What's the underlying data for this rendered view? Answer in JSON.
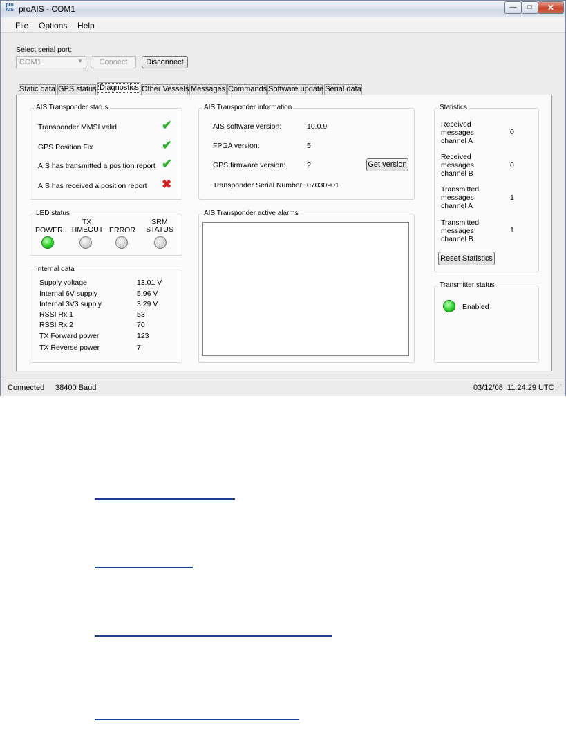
{
  "window": {
    "title": "proAIS - COM1",
    "logo_text": "pro AIS",
    "minimize_glyph": "—",
    "maximize_glyph": "□",
    "close_glyph": "✕"
  },
  "menu": {
    "file": "File",
    "options": "Options",
    "help": "Help"
  },
  "serial": {
    "label": "Select serial port:",
    "selected_port": "COM1",
    "connect_label": "Connect",
    "disconnect_label": "Disconnect"
  },
  "tabs": [
    {
      "label": "Static data"
    },
    {
      "label": "GPS status"
    },
    {
      "label": "Diagnostics"
    },
    {
      "label": "Other Vessels"
    },
    {
      "label": "Messages"
    },
    {
      "label": "Commands"
    },
    {
      "label": "Software update"
    },
    {
      "label": "Serial data"
    }
  ],
  "transponder_status": {
    "title": "AIS Transponder status",
    "items": [
      {
        "label": "Transponder MMSI valid",
        "ok": true
      },
      {
        "label": "GPS Position Fix",
        "ok": true
      },
      {
        "label": "AIS has transmitted a position report",
        "ok": true
      },
      {
        "label": "AIS has received a position report",
        "ok": false
      }
    ],
    "check_glyph": "✔",
    "cross_glyph": "✖"
  },
  "led_status": {
    "title": "LED status",
    "leds": [
      {
        "label": "POWER",
        "on": true
      },
      {
        "label": "TX\nTIMEOUT",
        "on": false
      },
      {
        "label": "ERROR",
        "on": false
      },
      {
        "label": "SRM\nSTATUS",
        "on": false
      }
    ]
  },
  "internal_data": {
    "title": "Internal data",
    "rows": [
      {
        "label": "Supply voltage",
        "value": "13.01 V"
      },
      {
        "label": "Internal 6V supply",
        "value": "5.96 V"
      },
      {
        "label": "Internal 3V3 supply",
        "value": "3.29 V"
      },
      {
        "label": "RSSI Rx 1",
        "value": "53"
      },
      {
        "label": "RSSI Rx 2",
        "value": "70"
      },
      {
        "label": "TX Forward power",
        "value": "123"
      },
      {
        "label": "TX Reverse power",
        "value": "7"
      }
    ]
  },
  "transponder_info": {
    "title": "AIS Transponder information",
    "rows": [
      {
        "label": "AIS software version:",
        "value": "10.0.9"
      },
      {
        "label": "FPGA version:",
        "value": "5"
      },
      {
        "label": "GPS firmware version:",
        "value": "?"
      },
      {
        "label": "Transponder Serial Number:",
        "value": "07030901"
      }
    ],
    "get_version_label": "Get version"
  },
  "alarms": {
    "title": "AIS Transponder active alarms"
  },
  "statistics": {
    "title": "Statistics",
    "rows": [
      {
        "label": "Received\nmessages\nchannel A",
        "value": "0"
      },
      {
        "label": "Received\nmessages\nchannel B",
        "value": "0"
      },
      {
        "label": "Transmitted\nmessages\nchannel A",
        "value": "1"
      },
      {
        "label": "Transmitted\nmessages\nchannel B",
        "value": "1"
      }
    ],
    "reset_label": "Reset Statistics"
  },
  "transmitter": {
    "title": "Transmitter status",
    "state": "Enabled"
  },
  "statusbar": {
    "connection": "Connected",
    "baud": "38400 Baud",
    "datetime": "03/12/08  11:24:29 UTC",
    "grip_glyph": "⋰"
  },
  "colors": {
    "ok": "#2fb02f",
    "error": "#d02020",
    "led_on": "#2ed12e",
    "link": "#1a3f99"
  }
}
